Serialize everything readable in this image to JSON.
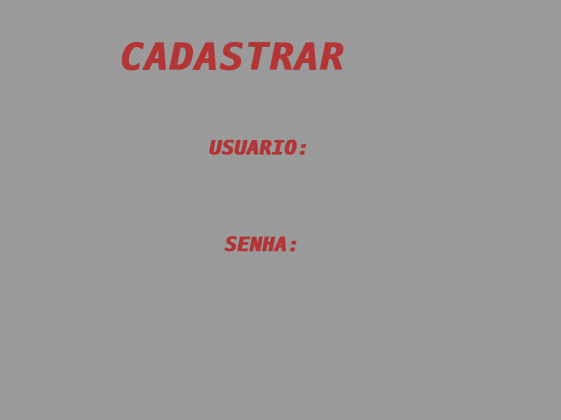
{
  "screen": {
    "title": "CADASTRAR",
    "fields": {
      "username_label": "USUARIO:",
      "username_value": "",
      "password_label": "SENHA:",
      "password_value": ""
    }
  },
  "colors": {
    "background": "#9a9a9a",
    "text": "#b33535"
  }
}
